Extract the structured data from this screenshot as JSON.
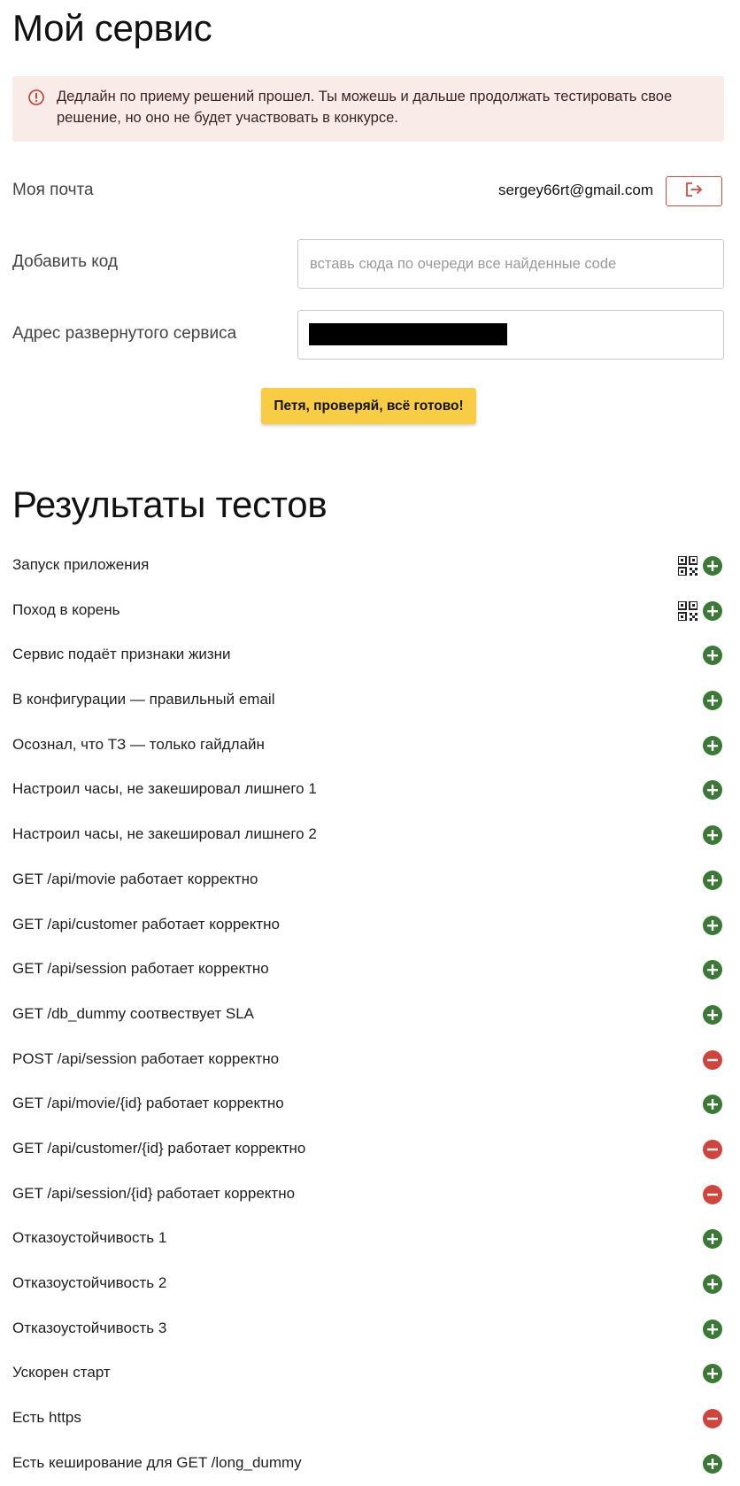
{
  "page": {
    "title": "Мой сервис"
  },
  "alert": {
    "icon": "exclamation-circle-icon",
    "text": "Дедлайн по приему решений прошел. Ты можешь и дальше продолжать тестировать свое решение, но оно не будет участвовать в конкурсе."
  },
  "email": {
    "label": "Моя почта",
    "value": "sergey66rt@gmail.com",
    "logout_icon": "logout-icon"
  },
  "code": {
    "label": "Добавить код",
    "placeholder": "вставь сюда по очереди все найденные code",
    "value": ""
  },
  "address": {
    "label": "Адрес развернутого сервиса",
    "value_redacted": true
  },
  "submit": {
    "label": "Петя, проверяй, всё готово!"
  },
  "results": {
    "title": "Результаты тестов",
    "tests": [
      {
        "name": "Запуск приложения",
        "status": "pass",
        "has_qr": true
      },
      {
        "name": "Поход в корень",
        "status": "pass",
        "has_qr": true
      },
      {
        "name": "Сервис подаёт признаки жизни",
        "status": "pass",
        "has_qr": false
      },
      {
        "name": "В конфигурации — правильный email",
        "status": "pass",
        "has_qr": false
      },
      {
        "name": "Осознал, что ТЗ — только гайдлайн",
        "status": "pass",
        "has_qr": false
      },
      {
        "name": "Настроил часы, не закешировал лишнего 1",
        "status": "pass",
        "has_qr": false
      },
      {
        "name": "Настроил часы, не закешировал лишнего 2",
        "status": "pass",
        "has_qr": false
      },
      {
        "name": "GET /api/movie работает корректно",
        "status": "pass",
        "has_qr": false
      },
      {
        "name": "GET /api/customer работает корректно",
        "status": "pass",
        "has_qr": false
      },
      {
        "name": "GET /api/session работает корректно",
        "status": "pass",
        "has_qr": false
      },
      {
        "name": "GET /db_dummy соотвествует SLA",
        "status": "pass",
        "has_qr": false
      },
      {
        "name": "POST /api/session работает корректно",
        "status": "fail",
        "has_qr": false
      },
      {
        "name": "GET /api/movie/{id} работает корректно",
        "status": "pass",
        "has_qr": false
      },
      {
        "name": "GET /api/customer/{id} работает корректно",
        "status": "fail",
        "has_qr": false
      },
      {
        "name": "GET /api/session/{id} работает корректно",
        "status": "fail",
        "has_qr": false
      },
      {
        "name": "Отказоустойчивость 1",
        "status": "pass",
        "has_qr": false
      },
      {
        "name": "Отказоустойчивость 2",
        "status": "pass",
        "has_qr": false
      },
      {
        "name": "Отказоустойчивость 3",
        "status": "pass",
        "has_qr": false
      },
      {
        "name": "Ускорен старт",
        "status": "pass",
        "has_qr": false
      },
      {
        "name": "Есть https",
        "status": "fail",
        "has_qr": false
      },
      {
        "name": "Есть кеширование для GET /long_dummy",
        "status": "pass",
        "has_qr": false
      }
    ]
  },
  "colors": {
    "pass": "#3b7a36",
    "fail": "#d0443b",
    "alert_bg": "#f9ebe8",
    "accent_button": "#f8cd44",
    "logout_border": "#d64a3c"
  }
}
